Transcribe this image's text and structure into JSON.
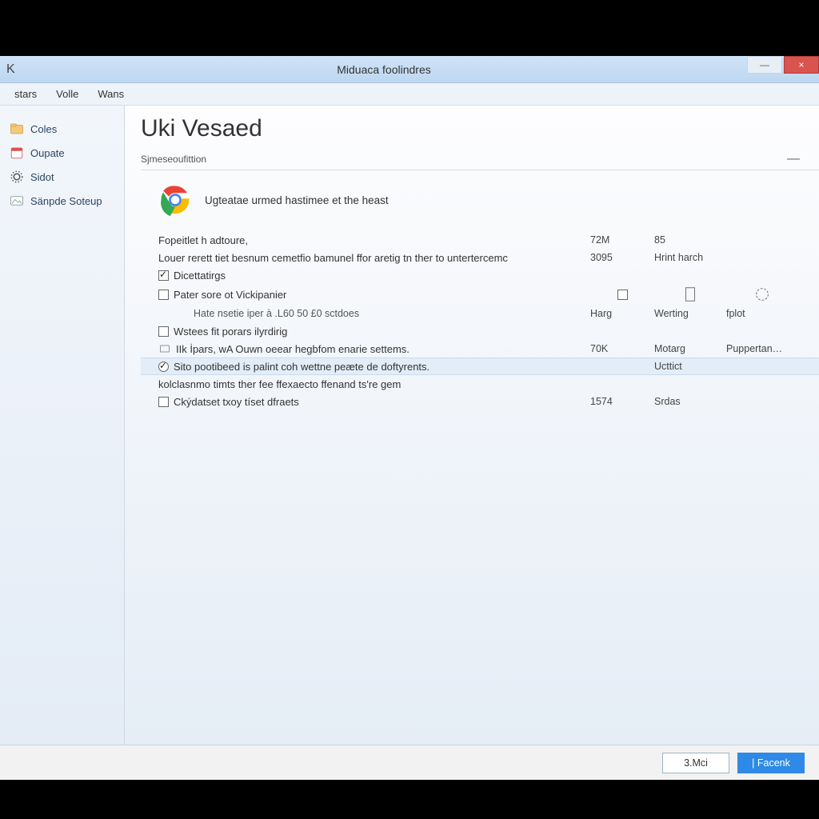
{
  "window": {
    "app_letter": "K",
    "title": "Miduaca foolindres",
    "minimize": "—",
    "close": "×"
  },
  "menubar": {
    "items": [
      "stars",
      "Volle",
      "Wans"
    ]
  },
  "sidebar": {
    "items": [
      {
        "label": "Coles",
        "icon": "folder-icon"
      },
      {
        "label": "Oupate",
        "icon": "calendar-icon"
      },
      {
        "label": "Sidot",
        "icon": "gear-icon"
      },
      {
        "label": "Sänpde Soteup",
        "icon": "image-icon"
      }
    ]
  },
  "main": {
    "heading": "Uki Vesaed",
    "section_label": "Sjmeseoufittion",
    "hero_text": "Ugteatae urmed hastimee et the heast",
    "columns": {
      "col1_header": "Fopeitlet h adtoure,",
      "col2_header": "72M",
      "col3_header": "85",
      "subheader": "Louer rerett tiet besnum cemetfio bamunel ffor aretig tn ther to untertercemc",
      "sub_col2": "3095",
      "sub_col3": "Hrint harch"
    },
    "rows": [
      {
        "kind": "check",
        "checked": true,
        "label": "Dicettatirgs"
      },
      {
        "kind": "check",
        "checked": false,
        "label": "Pater sore ot Vickipanier",
        "col2_icon": "box",
        "col3_icon": "doc",
        "col4_icon": "gear",
        "col2_cap": "Harg",
        "col3_cap": "Werting",
        "col4_cap": "fplot"
      },
      {
        "kind": "indent",
        "label": "Hate nsetie iper à .L60 50 £0 sctdoes"
      },
      {
        "kind": "check",
        "checked": false,
        "label": "Wstees fit porars ilyrdirig"
      },
      {
        "kind": "icon",
        "label": "IIk İpars, wA Ouwn oeear hegbfom enarie settems.",
        "col2": "70K",
        "col3": "Motarg",
        "col4": "Puppertan…"
      },
      {
        "kind": "radio",
        "selected": true,
        "label": "Sito pootibeed is palint coh wettne peæte de doftyrents.",
        "col3": "Ucttict"
      },
      {
        "kind": "plain",
        "label": "kolclasnmo timts ther fee ffexaecto ffenand ts're gem"
      },
      {
        "kind": "check",
        "checked": false,
        "label": "Ckýdatset txoy tíset dfraets",
        "col2": "1574",
        "col3": "Srdas"
      }
    ]
  },
  "footer": {
    "secondary": "3.Mci",
    "primary": "|   Facenk"
  }
}
